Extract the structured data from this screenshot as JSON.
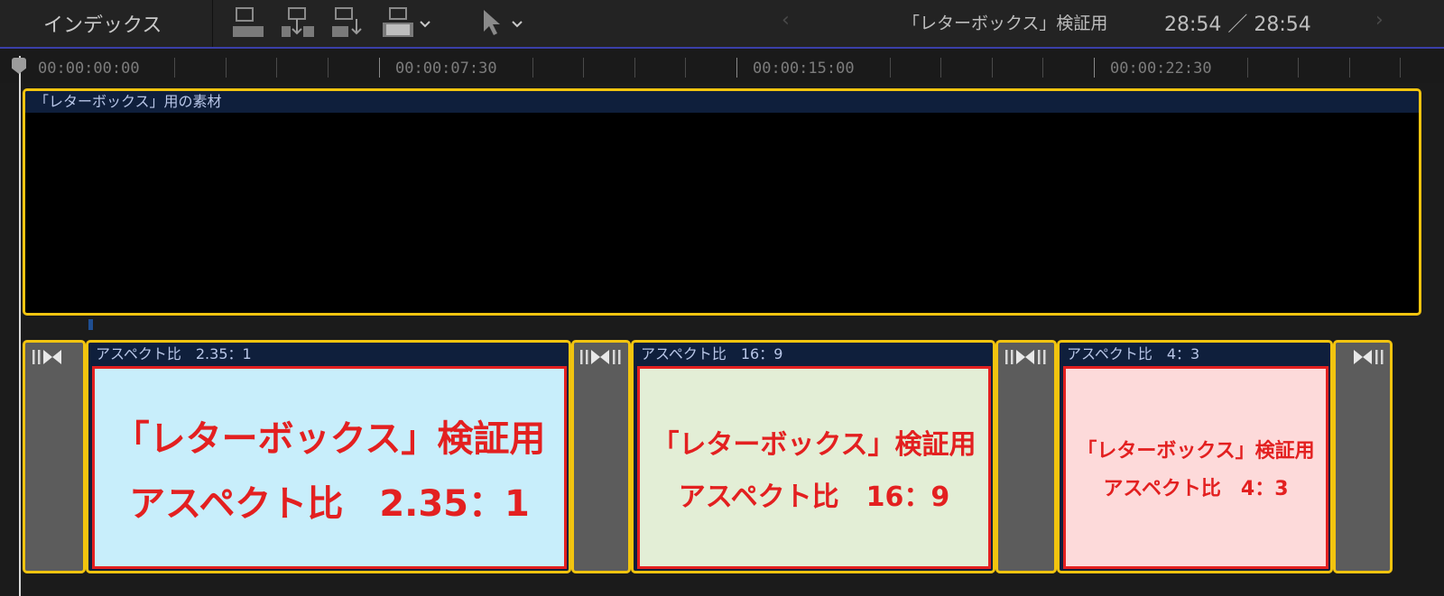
{
  "toolbar": {
    "index_label": "インデックス",
    "project_name": "「レターボックス」検証用",
    "timecode": "28:54 ／ 28:54",
    "prev_glyph": "‹",
    "next_glyph": "›",
    "icons": [
      "connect-clip-icon",
      "insert-clip-icon",
      "append-clip-icon",
      "overwrite-clip-icon",
      "select-tool-icon"
    ]
  },
  "ruler": {
    "labels": [
      "00:00:00:00",
      "00:00:07:30",
      "00:00:15:00",
      "00:00:22:30"
    ]
  },
  "upper_clip": {
    "name": "「レターボックス」用の素材"
  },
  "clips": [
    {
      "name": "アスペクト比　2.35：1",
      "line1": "「レターボックス」検証用",
      "line2": "アスペクト比　2.35：1",
      "bg": "#c8eefb"
    },
    {
      "name": "アスペクト比　16：9",
      "line1": "「レターボックス」検証用",
      "line2": "アスペクト比　16：9",
      "bg": "#e3eed6"
    },
    {
      "name": "アスペクト比　4：3",
      "line1": "「レターボックス」検証用",
      "line2": "アスペクト比　4：3",
      "bg": "#fddada"
    }
  ],
  "colors": {
    "selection": "#f2c40f",
    "clip_header": "#0f1f3c",
    "text_red": "#e32020",
    "transition": "#5c5c5c"
  }
}
